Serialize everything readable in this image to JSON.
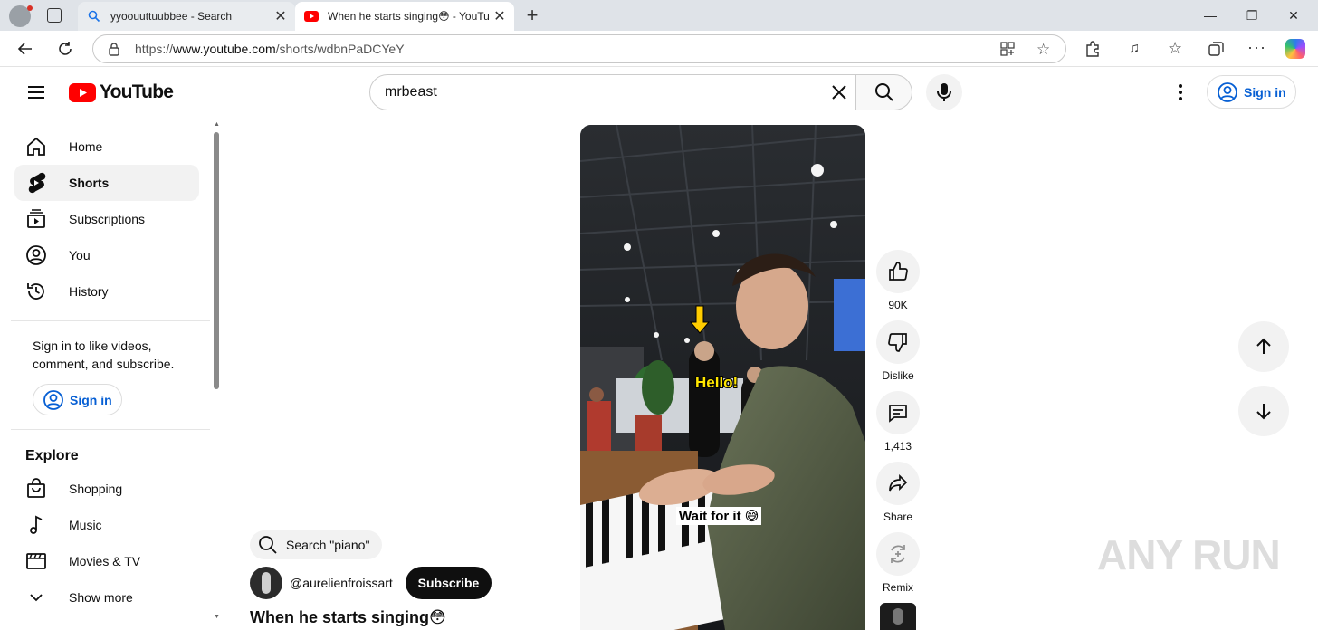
{
  "browser": {
    "tabs": [
      {
        "label": "yyoouuttuubbee - Search",
        "active": false
      },
      {
        "label": "When he starts singing😳 - YouTu",
        "active": true
      }
    ],
    "url_prefix": "https://",
    "url_domain": "www.youtube.com",
    "url_path": "/shorts/wdbnPaDCYeY"
  },
  "header": {
    "logo_text": "YouTube",
    "search_value": "mrbeast",
    "signin_label": "Sign in"
  },
  "sidebar": {
    "items": [
      {
        "label": "Home",
        "icon": "home-icon"
      },
      {
        "label": "Shorts",
        "icon": "shorts-icon"
      },
      {
        "label": "Subscriptions",
        "icon": "subscriptions-icon"
      },
      {
        "label": "You",
        "icon": "you-icon"
      },
      {
        "label": "History",
        "icon": "history-icon"
      }
    ],
    "signin_message": "Sign in to like videos, comment, and subscribe.",
    "signin_label": "Sign in",
    "explore_heading": "Explore",
    "explore_items": [
      {
        "label": "Shopping",
        "icon": "shopping-icon"
      },
      {
        "label": "Music",
        "icon": "music-icon"
      },
      {
        "label": "Movies & TV",
        "icon": "movies-icon"
      },
      {
        "label": "Show more",
        "icon": "chevron-down-icon"
      }
    ]
  },
  "video": {
    "caption_hello": "Hello!",
    "caption_wait": "Wait for it 😅"
  },
  "actions": {
    "like_count": "90K",
    "dislike_label": "Dislike",
    "comment_count": "1,413",
    "share_label": "Share",
    "remix_label": "Remix"
  },
  "info": {
    "search_chip": "Search \"piano\"",
    "channel": "@aurelienfroissart",
    "subscribe_label": "Subscribe",
    "title": "When he starts singing😳"
  },
  "watermark": "ANY RUN"
}
